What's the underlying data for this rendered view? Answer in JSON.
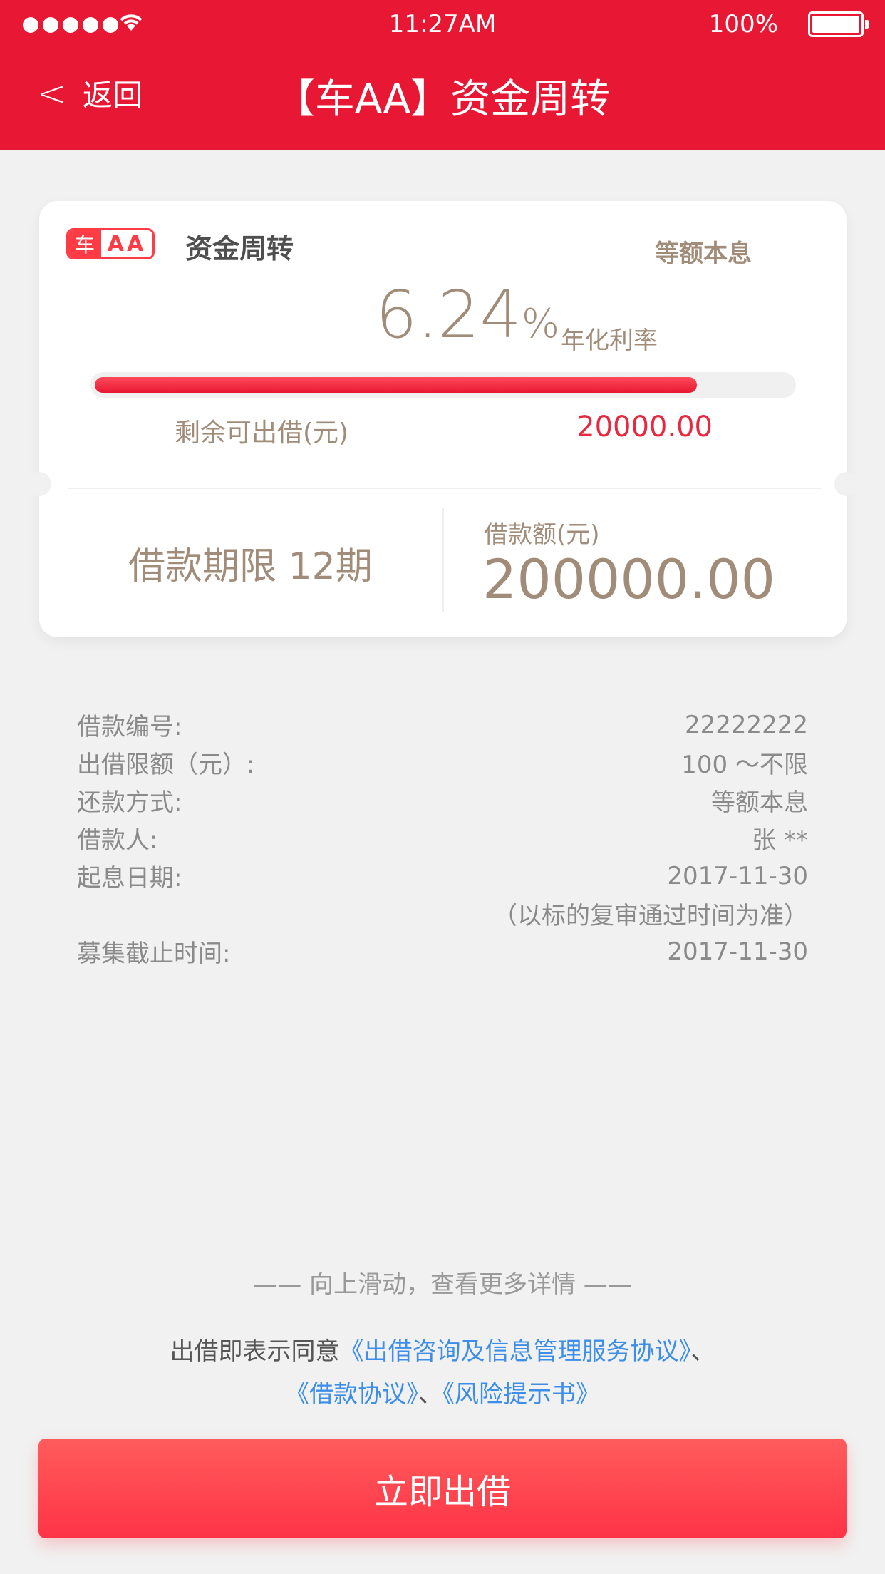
{
  "status_bar": {
    "time": "11:27AM",
    "battery": "100%"
  },
  "nav": {
    "back_label": "返回",
    "title": "【车AA】资金周转"
  },
  "card": {
    "brand_char": "车",
    "brand_text": "AA",
    "product_name": "资金周转",
    "repay_method": "等额本息",
    "rate_value": "6.24",
    "rate_unit": "%",
    "rate_label": "年化利率",
    "progress_percent": 86,
    "remain_label": "剩余可出借(元)",
    "remain_value": "20000.00",
    "term_text": "借款期限 12期",
    "amount_label": "借款额(元)",
    "amount_value": "200000.00"
  },
  "details": [
    {
      "label": "借款编号:",
      "value": "22222222"
    },
    {
      "label": "出借限额（元）:",
      "value": "100 ～不限"
    },
    {
      "label": "还款方式:",
      "value": "等额本息"
    },
    {
      "label": "借款人:",
      "value": "张 **"
    },
    {
      "label": "起息日期:",
      "value": "2017-11-30"
    },
    {
      "label": "",
      "value": "（以标的复审通过时间为准）"
    },
    {
      "label": "募集截止时间:",
      "value": "2017-11-30"
    }
  ],
  "scroll_hint": "—— 向上滑动，查看更多详情 ——",
  "agreement": {
    "prefix": "出借即表示同意",
    "link1": "《出借咨询及信息管理服务协议》",
    "sep1": "、",
    "link2": "《借款协议》",
    "sep2": "、",
    "link3": "《风险提示书》"
  },
  "cta_label": "立即出借",
  "colors": {
    "brand_red": "#e81733",
    "accent_gold": "#a08c78",
    "link_blue": "#3d8ee8"
  }
}
